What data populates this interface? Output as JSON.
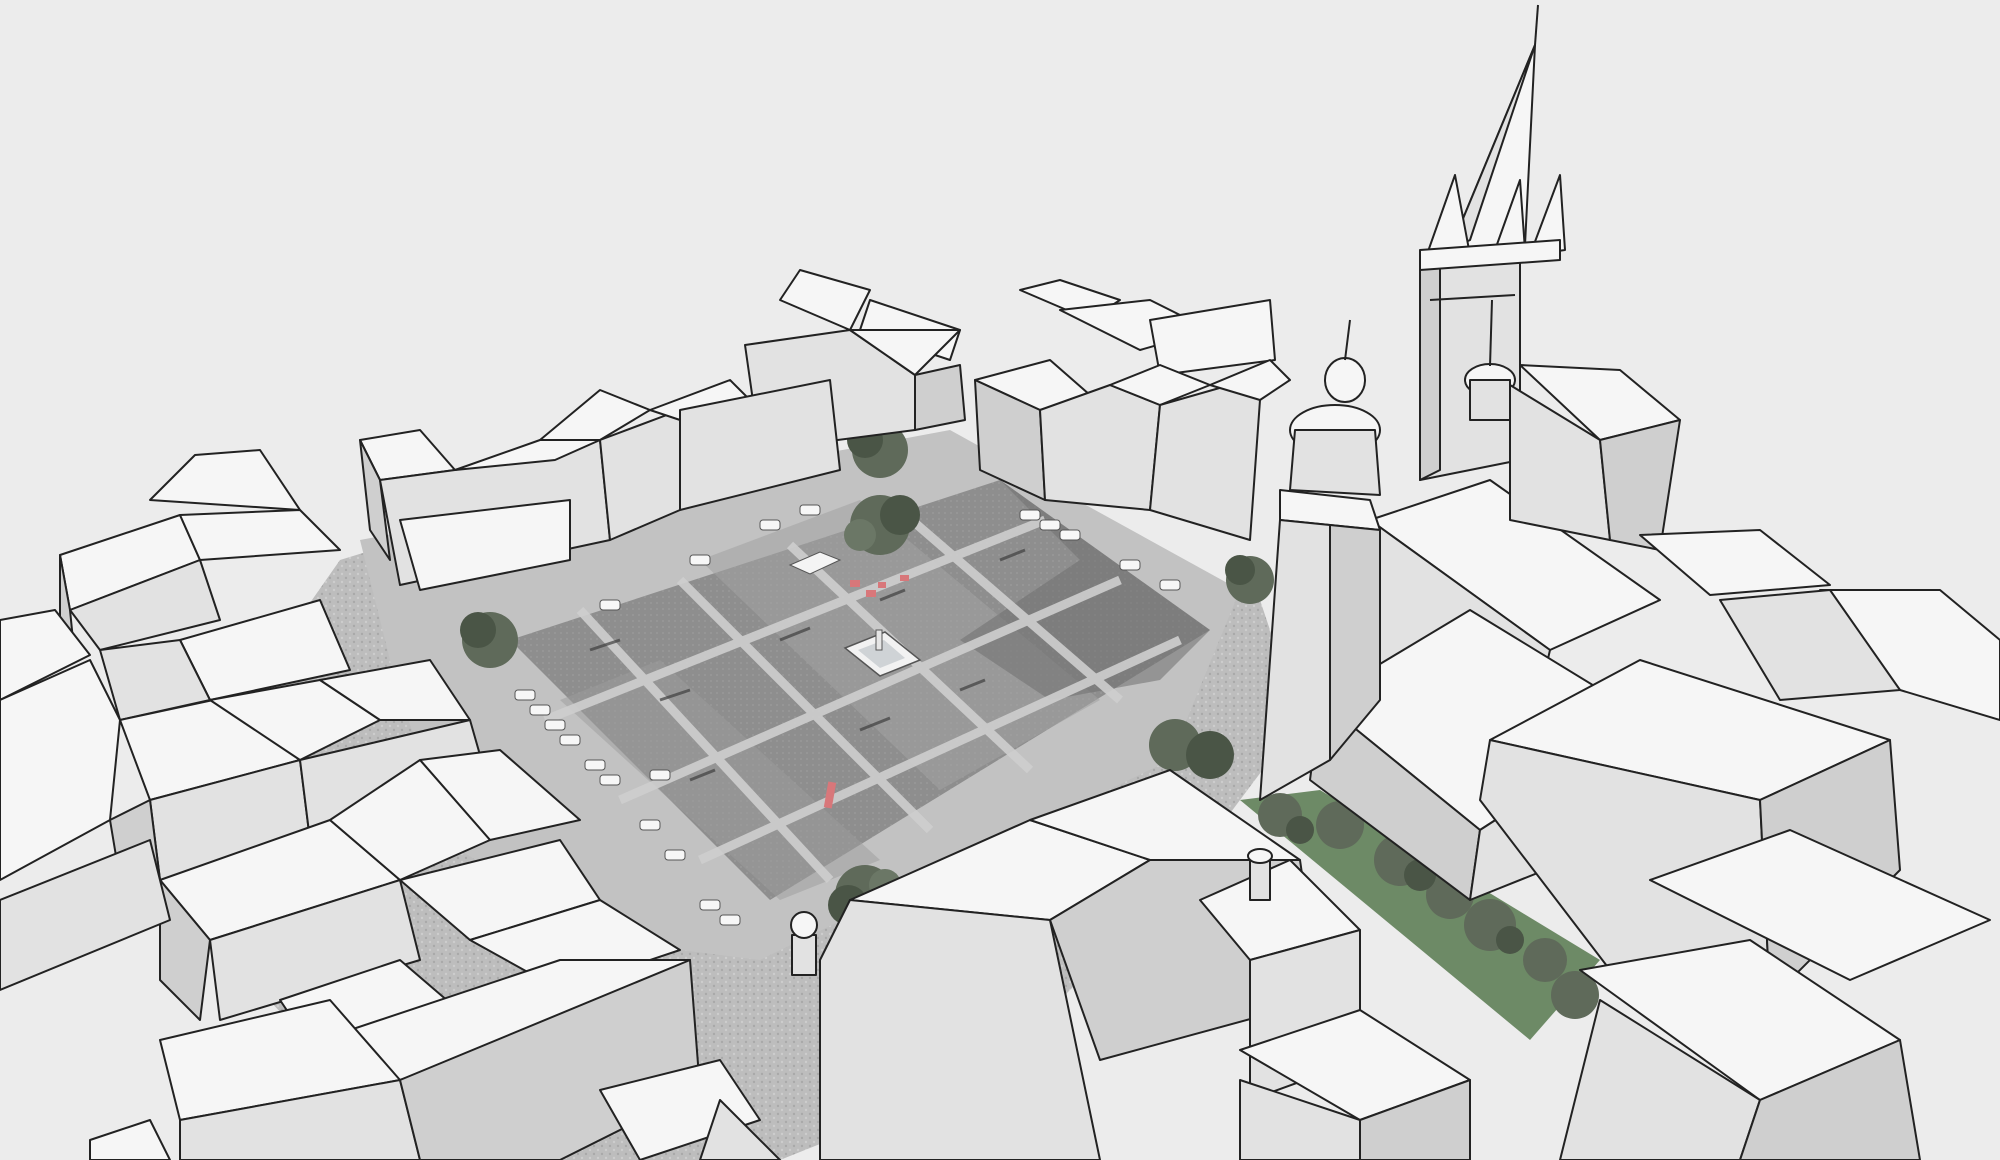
{
  "scene": {
    "colors": {
      "background": "#ececec",
      "plaza": "#8f8f8f",
      "plaza_light": "#a9a9a9",
      "paving_band": "#c6c6c6",
      "cobble": "#b9b9b9",
      "roof": "#f6f6f6",
      "wall_light": "#e2e2e2",
      "wall_shade": "#cfcfcf",
      "shadow": "#7e7e7e",
      "outline": "#222222",
      "tree": "#5f6a5a",
      "tree_dark": "#4a5546",
      "grass": "#6d8a66",
      "accent_red": "#d8777a"
    }
  }
}
